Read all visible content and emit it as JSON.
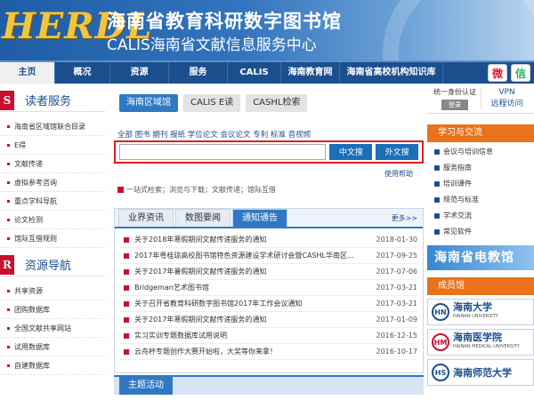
{
  "header": {
    "logo": "HERDL",
    "title_cn": "海南省教育科研数字图书馆",
    "title_en": "CALIS海南省文献信息服务中心"
  },
  "nav": {
    "items": [
      {
        "label": "主页",
        "active": true
      },
      {
        "label": "概况"
      },
      {
        "label": "资源"
      },
      {
        "label": "服务"
      },
      {
        "label": "CALIS"
      },
      {
        "label": "海南教育网"
      },
      {
        "label": "海南省高校机构知识库"
      }
    ],
    "icons": [
      "weibo-icon",
      "wechat-icon"
    ]
  },
  "sidebar": {
    "sections": [
      {
        "badge": "S",
        "title": "读者服务",
        "items": [
          "海南省区域馆联合目录",
          "E得",
          "文献传递",
          "虚拟参考咨询",
          "重点学科导航",
          "论文检测",
          "馆际互借规则"
        ]
      },
      {
        "badge": "R",
        "title": "资源导航",
        "items": [
          "共享资源",
          "团购数据库",
          "全国文献共享网站",
          "试用数据库",
          "自建数据库"
        ]
      }
    ]
  },
  "search": {
    "tabs": [
      "海南区域馆",
      "CALIS E读",
      "CASHL检索"
    ],
    "types": "全部  图书  期刊  报纸  学位论文  会议论文  专利  标准  音视频",
    "input_placeholder": "",
    "btn_cn": "中文搜索",
    "btn_foreign": "外文搜索",
    "help": "使用帮助",
    "onestop": "一站式检索；浏览与下载；文献传递；馆际互借"
  },
  "news": {
    "tabs": [
      "业界资讯",
      "数图要闻",
      "通知通告"
    ],
    "active_tab": 2,
    "more": "更多>>",
    "items": [
      {
        "title": "关于2018年寒假期间文献传递服务的通知",
        "date": "2018-01-30"
      },
      {
        "title": "2017年粤桂琼高校图书馆特色资源建设学术研讨会暨CASHL华南区...",
        "date": "2017-09-25"
      },
      {
        "title": "关于2017年暑假期间文献传递服务的通知",
        "date": "2017-07-06"
      },
      {
        "title": "Bridgeman艺术图书馆",
        "date": "2017-03-21"
      },
      {
        "title": "关于召开省教育科研数字图书馆2017年工作会议通知",
        "date": "2017-03-21"
      },
      {
        "title": "关于2017年寒假期间文献传递服务的通知",
        "date": "2017-01-09"
      },
      {
        "title": "实习实训专题数据库试用说明",
        "date": "2016-12-15"
      },
      {
        "title": "云舟杯专题创作大赛开始啦，大奖等你来拿！",
        "date": "2016-10-17"
      }
    ]
  },
  "topic": {
    "label": "主题活动"
  },
  "right": {
    "login_title": "统一身份认证",
    "login_btn": "登录",
    "vpn_title": "VPN",
    "vpn_sub": "远程访问",
    "learn_head": "学习与交流",
    "learn_items": [
      "会议与培训信息",
      "服务指南",
      "培训课件",
      "规范与标准",
      "学术交流",
      "常见软件"
    ],
    "banner": "海南省电教馆",
    "member_head": "成员馆",
    "members": [
      {
        "name": "海南大学",
        "sub": "HAINAN UNIVERSITY"
      },
      {
        "name": "海南医学院",
        "sub": "HAINAN MEDICAL UNIVERSITY"
      },
      {
        "name": "海南师范大学",
        "sub": ""
      }
    ]
  }
}
